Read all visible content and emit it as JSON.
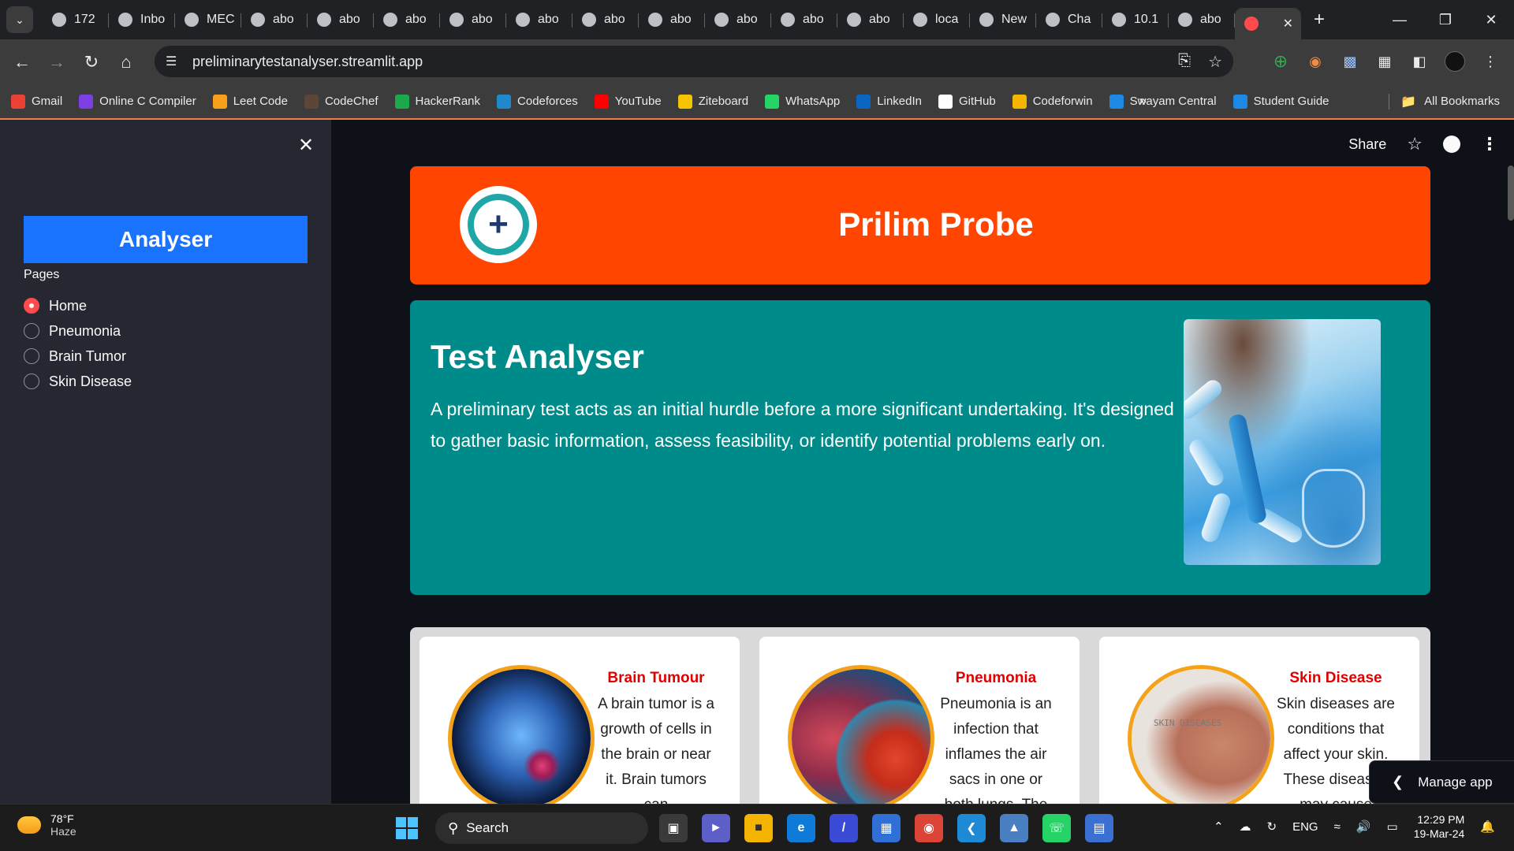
{
  "browser": {
    "tabs": [
      {
        "label": "172",
        "icon": "globe-icon"
      },
      {
        "label": "Inbo",
        "icon": "gmail-icon"
      },
      {
        "label": "MEC",
        "icon": "mec-icon"
      },
      {
        "label": "abo",
        "icon": "globe-icon"
      },
      {
        "label": "abo",
        "icon": "globe-icon"
      },
      {
        "label": "abo",
        "icon": "globe-icon"
      },
      {
        "label": "abo",
        "icon": "globe-icon"
      },
      {
        "label": "abo",
        "icon": "globe-icon"
      },
      {
        "label": "abo",
        "icon": "globe-icon"
      },
      {
        "label": "abo",
        "icon": "globe-icon"
      },
      {
        "label": "abo",
        "icon": "globe-icon"
      },
      {
        "label": "abo",
        "icon": "globe-icon"
      },
      {
        "label": "abo",
        "icon": "globe-icon"
      },
      {
        "label": "loca",
        "icon": "streamlit-icon"
      },
      {
        "label": "New",
        "icon": "chrome-icon"
      },
      {
        "label": "Cha",
        "icon": "chatgpt-icon"
      },
      {
        "label": "10.1",
        "icon": "streamlit-icon"
      },
      {
        "label": "abo",
        "icon": "globe-icon"
      }
    ],
    "url": "preliminarytestanalyser.streamlit.app",
    "bookmarks": [
      {
        "label": "Gmail",
        "icon": "gmail-icon",
        "color": "#ea4335"
      },
      {
        "label": "Online C Compiler",
        "icon": "bolt-icon",
        "color": "#7b3fe4"
      },
      {
        "label": "Leet Code",
        "icon": "leetcode-icon",
        "color": "#f89f1b"
      },
      {
        "label": "CodeChef",
        "icon": "codechef-icon",
        "color": "#5b4638"
      },
      {
        "label": "HackerRank",
        "icon": "hackerrank-icon",
        "color": "#1ba94c"
      },
      {
        "label": "Codeforces",
        "icon": "codeforces-icon",
        "color": "#1f8acb"
      },
      {
        "label": "YouTube",
        "icon": "youtube-icon",
        "color": "#ff0000"
      },
      {
        "label": "Ziteboard",
        "icon": "ziteboard-icon",
        "color": "#f5c400"
      },
      {
        "label": "WhatsApp",
        "icon": "whatsapp-icon",
        "color": "#25d366"
      },
      {
        "label": "LinkedIn",
        "icon": "linkedin-icon",
        "color": "#0a66c2"
      },
      {
        "label": "GitHub",
        "icon": "github-icon",
        "color": "#ffffff"
      },
      {
        "label": "Codeforwin",
        "icon": "codeforwin-icon",
        "color": "#f4b400"
      },
      {
        "label": "Swayam Central",
        "icon": "swayam-icon",
        "color": "#1e88e5"
      },
      {
        "label": "Student Guide",
        "icon": "cloud-icon",
        "color": "#1e88e5"
      }
    ],
    "all_bookmarks": "All Bookmarks"
  },
  "sidebar": {
    "title": "Analyser",
    "pages_label": "Pages",
    "pages": [
      {
        "label": "Home",
        "selected": true
      },
      {
        "label": "Pneumonia",
        "selected": false
      },
      {
        "label": "Brain Tumor",
        "selected": false
      },
      {
        "label": "Skin Disease",
        "selected": false
      }
    ]
  },
  "app_header": {
    "share_label": "Share"
  },
  "banner": {
    "title": "Prilim Probe",
    "color": "#ff4500"
  },
  "intro": {
    "heading": "Test Analyser",
    "text": "A preliminary test acts as an initial hurdle before a more significant undertaking. It's designed to gather basic information, assess feasibility, or identify potential problems early on.",
    "color": "#008b8b"
  },
  "cards": [
    {
      "title": "Brain Tumour",
      "text": "A brain tumor is a growth of cells in the brain or near it. Brain tumors can"
    },
    {
      "title": "Pneumonia",
      "text": "Pneumonia is an infection that inflames the air sacs in one or both lungs. The"
    },
    {
      "title": "Skin Disease",
      "text": "Skin diseases are conditions that affect your skin. These diseases may cause",
      "image_text": "SKIN DISEASES"
    }
  ],
  "manage_app": "Manage app",
  "taskbar": {
    "weather_temp": "78°F",
    "weather_desc": "Haze",
    "search_label": "Search",
    "language": "ENG",
    "time": "12:29 PM",
    "date": "19-Mar-24"
  }
}
